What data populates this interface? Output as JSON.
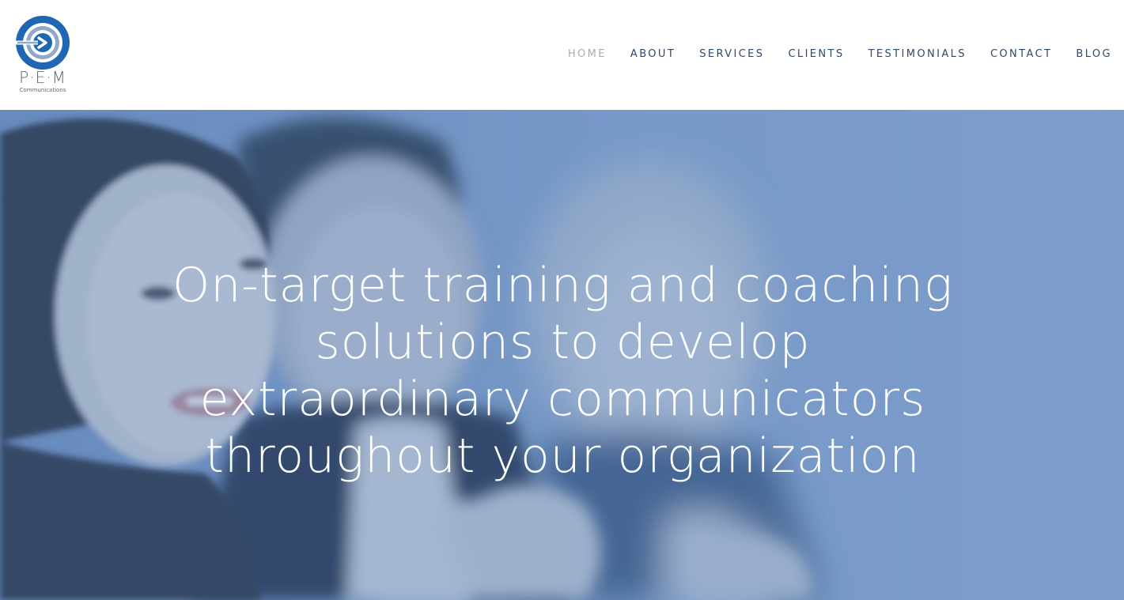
{
  "header": {
    "logo": {
      "letters": "P·E·M",
      "subtitle": "Communications",
      "colors": {
        "ring": "#1f67b3",
        "text": "#5b6670"
      }
    },
    "nav": {
      "items": [
        {
          "label": "HOME",
          "active": true
        },
        {
          "label": "ABOUT",
          "active": false
        },
        {
          "label": "SERVICES",
          "active": false
        },
        {
          "label": "CLIENTS",
          "active": false
        },
        {
          "label": "TESTIMONIALS",
          "active": false
        },
        {
          "label": "CONTACT",
          "active": false
        },
        {
          "label": "BLOG",
          "active": false
        }
      ],
      "colors": {
        "link": "#2c4a6e",
        "active": "#a8acb3"
      }
    }
  },
  "hero": {
    "title": "On-target training and coaching solutions to develop extraordinary communicators throughout your organization",
    "overlay_color": "#547eba",
    "image_icon": "applauding-colleagues-photo"
  }
}
